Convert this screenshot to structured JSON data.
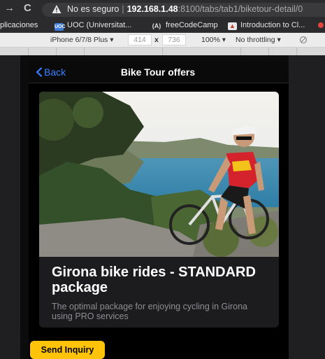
{
  "browser": {
    "security_label": "No es seguro",
    "url_host": "192.168.1.48",
    "url_path": ":8100/tabs/tab1/biketour-detail/0"
  },
  "bookmarks": [
    {
      "label": "plicaciones",
      "icon": "apps-icon"
    },
    {
      "label": "UOC (Universitat...",
      "icon": "uoc-icon"
    },
    {
      "label": "freeCodeCamp",
      "icon": "freecodecamp-icon"
    },
    {
      "label": "Introduction to Cl...",
      "icon": "bookmark-icon"
    }
  ],
  "device_toolbar": {
    "device": "iPhone 6/7/8 Plus ▾",
    "width": "414",
    "height": "736",
    "times": "x",
    "zoom": "100% ▾",
    "throttling": "No throttling ▾"
  },
  "app": {
    "back_label": "Back",
    "title": "Bike Tour offers",
    "accent_color": "#3880ff"
  },
  "card": {
    "title": "Girona bike rides - STANDARD package",
    "subtitle": "The optimal package for enjoying cycling in Girona using PRO services"
  },
  "inquiry_button": {
    "label": "Send Inquiry",
    "color": "#ffc409"
  }
}
